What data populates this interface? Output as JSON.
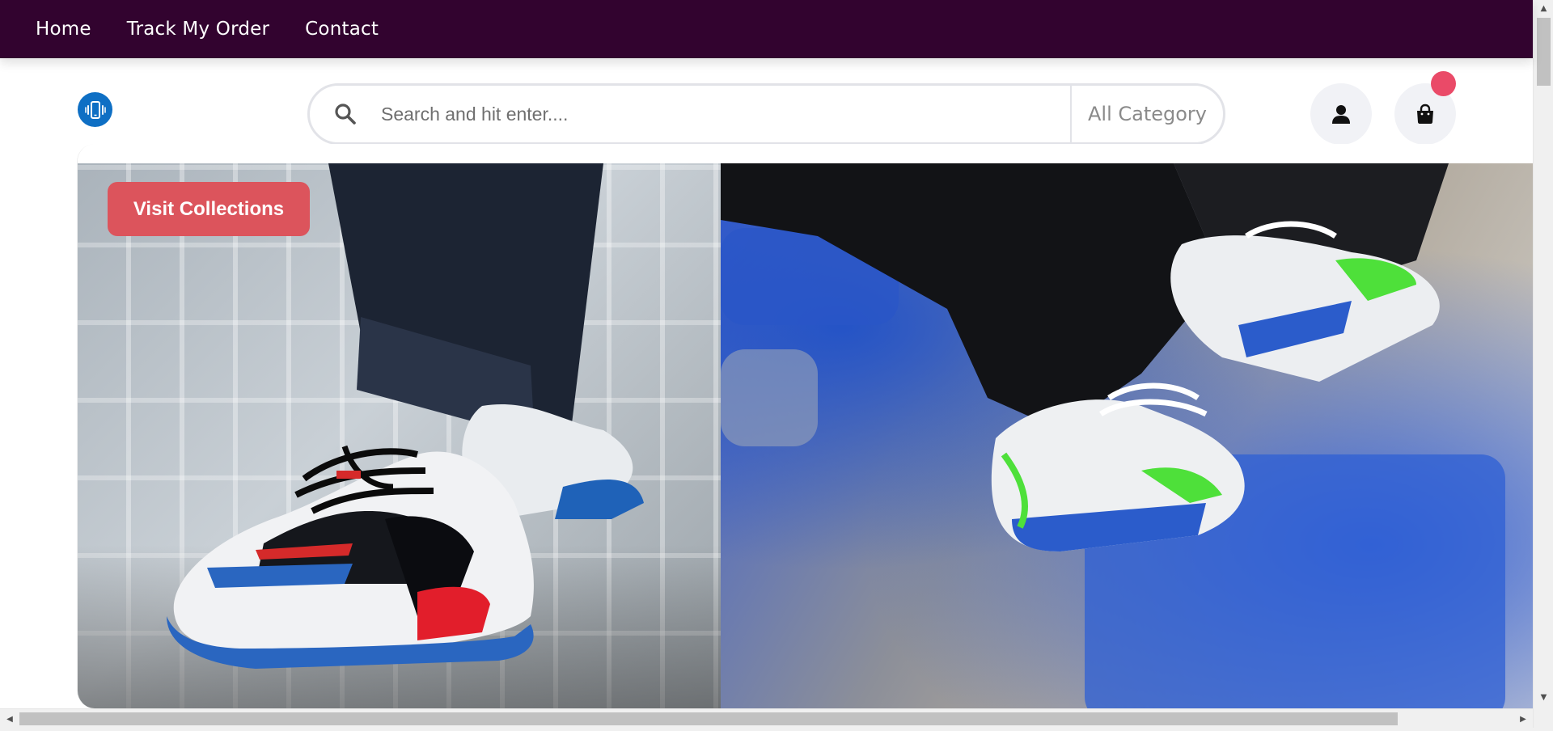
{
  "nav": {
    "items": [
      {
        "label": "Home"
      },
      {
        "label": "Track My Order"
      },
      {
        "label": "Contact"
      }
    ]
  },
  "header": {
    "logo_icon": "phone-vibrate-icon",
    "search": {
      "placeholder": "Search and hit enter....",
      "value": "",
      "icon": "search-icon",
      "category_label": "All Category"
    },
    "user_icon": "user-icon",
    "cart_icon": "shopping-bag-icon",
    "cart_badge_color": "#ea4a68"
  },
  "hero": {
    "cta_label": "Visit Collections",
    "cta_color": "#dc545c"
  },
  "colors": {
    "nav_background": "#32032f",
    "logo": "#0e6fc4"
  }
}
